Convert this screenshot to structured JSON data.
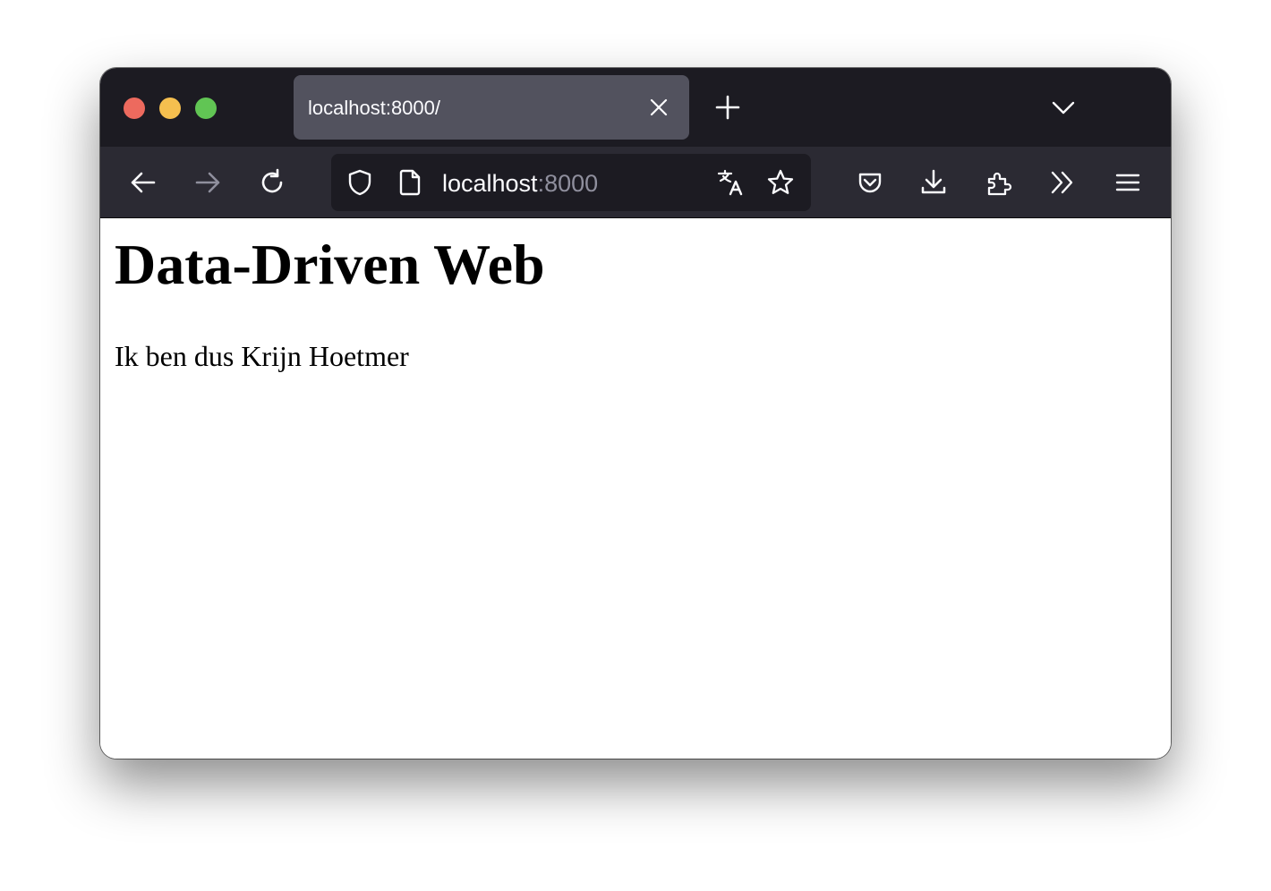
{
  "browser": {
    "tab": {
      "title": "localhost:8000/"
    },
    "urlbar": {
      "host": "localhost",
      "port": ":8000"
    },
    "icons": {
      "back": "arrow-left-icon",
      "forward": "arrow-right-icon",
      "reload": "reload-icon",
      "tracking_protection": "shield-icon",
      "page_info": "page-icon",
      "translate": "translate-icon",
      "bookmark": "star-icon",
      "pocket": "pocket-icon",
      "downloads": "download-icon",
      "extensions": "puzzle-icon",
      "overflow": "chevron-double-right-icon",
      "menu": "hamburger-menu-icon",
      "new_tab": "plus-icon",
      "tab_list": "chevron-down-icon",
      "tab_close": "close-icon"
    },
    "colors": {
      "tabstrip_bg": "#1c1b22",
      "toolbar_bg": "#2b2a33",
      "active_tab_bg": "#52525e",
      "close_light": "#ed6a5e",
      "minimize_light": "#f5bf4f",
      "maximize_light": "#61c554"
    }
  },
  "page": {
    "heading": "Data-Driven Web",
    "paragraph": "Ik ben dus Krijn Hoetmer"
  }
}
